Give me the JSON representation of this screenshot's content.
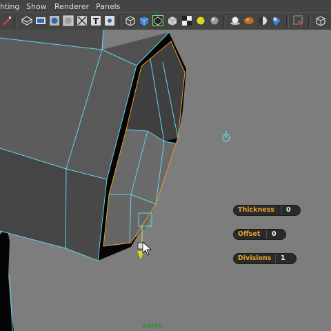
{
  "menu": {
    "items": [
      {
        "name": "lighting",
        "label": "hting"
      },
      {
        "name": "show",
        "label": "Show"
      },
      {
        "name": "renderer",
        "label": "Renderer"
      },
      {
        "name": "panels",
        "label": "Panels"
      }
    ]
  },
  "toolbar": {
    "icons": [
      "select-camera-icon",
      "wireframe-icon",
      "film-gate-icon",
      "resolution-gate-icon",
      "grid-icon",
      "xray-icon",
      "texture-icon",
      "bounding-box-icon",
      "smooth-shade-icon",
      "wireframe-on-shaded-icon",
      "checker-icon",
      "default-material-icon",
      "sphere-icon",
      "use-all-lights-icon",
      "shadows-icon",
      "ambient-occlusion-icon",
      "motion-blur-icon",
      "isolate-select-icon",
      "camera-icon"
    ]
  },
  "hud": {
    "thickness": {
      "label": "Thickness",
      "value": "0"
    },
    "offset": {
      "label": "Offset",
      "value": "0"
    },
    "divisions": {
      "label": "Divisions",
      "value": "1"
    }
  },
  "viewport": {
    "camera": "persp"
  },
  "colors": {
    "menubar_bg": "#444444",
    "viewport_bg": "#7d7d7d",
    "wire": "#5ed8ef",
    "hud_label": "#e8a02c",
    "hud_value": "#f2f2f2",
    "camera_label": "#3a8a3a"
  }
}
